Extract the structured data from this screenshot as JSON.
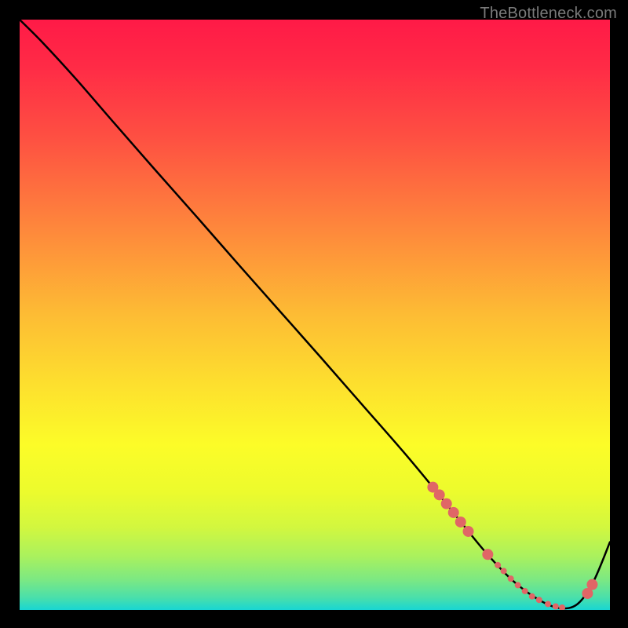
{
  "watermark": "TheBottleneck.com",
  "chart_data": {
    "type": "line",
    "title": "",
    "xlabel": "",
    "ylabel": "",
    "xlim": [
      0,
      1
    ],
    "ylim": [
      0,
      1
    ],
    "background_gradient": {
      "stops": [
        {
          "pos": 0.0,
          "color": "#ff1a47"
        },
        {
          "pos": 0.08,
          "color": "#ff2b46"
        },
        {
          "pos": 0.2,
          "color": "#fe5042"
        },
        {
          "pos": 0.35,
          "color": "#fe863c"
        },
        {
          "pos": 0.5,
          "color": "#fdbc34"
        },
        {
          "pos": 0.62,
          "color": "#fde02e"
        },
        {
          "pos": 0.72,
          "color": "#fcfc28"
        },
        {
          "pos": 0.8,
          "color": "#ecfb2d"
        },
        {
          "pos": 0.86,
          "color": "#d2f73f"
        },
        {
          "pos": 0.91,
          "color": "#a9f15e"
        },
        {
          "pos": 0.95,
          "color": "#7ae884"
        },
        {
          "pos": 0.98,
          "color": "#48dfac"
        },
        {
          "pos": 1.0,
          "color": "#18d6d3"
        }
      ]
    },
    "series": [
      {
        "name": "bottleneck-curve",
        "color": "#000000",
        "x": [
          0.0,
          0.04,
          0.095,
          0.16,
          0.23,
          0.3,
          0.37,
          0.44,
          0.51,
          0.58,
          0.65,
          0.7,
          0.745,
          0.79,
          0.835,
          0.88,
          0.915,
          0.945,
          0.972,
          1.0
        ],
        "y": [
          1.0,
          0.96,
          0.9,
          0.825,
          0.745,
          0.666,
          0.586,
          0.507,
          0.428,
          0.348,
          0.268,
          0.208,
          0.152,
          0.097,
          0.05,
          0.017,
          0.003,
          0.01,
          0.048,
          0.115
        ]
      }
    ],
    "scatter_points": {
      "name": "marked-range",
      "color": "#e06666",
      "radius_main": 7,
      "radius_dot": 4,
      "points": [
        {
          "x": 0.7,
          "y": 0.208,
          "r": 7
        },
        {
          "x": 0.711,
          "y": 0.195,
          "r": 7
        },
        {
          "x": 0.723,
          "y": 0.18,
          "r": 7
        },
        {
          "x": 0.735,
          "y": 0.165,
          "r": 7
        },
        {
          "x": 0.747,
          "y": 0.149,
          "r": 7
        },
        {
          "x": 0.76,
          "y": 0.133,
          "r": 7
        },
        {
          "x": 0.793,
          "y": 0.094,
          "r": 7
        },
        {
          "x": 0.81,
          "y": 0.076,
          "r": 4
        },
        {
          "x": 0.82,
          "y": 0.066,
          "r": 4
        },
        {
          "x": 0.832,
          "y": 0.053,
          "r": 4
        },
        {
          "x": 0.844,
          "y": 0.042,
          "r": 4
        },
        {
          "x": 0.856,
          "y": 0.032,
          "r": 4
        },
        {
          "x": 0.868,
          "y": 0.023,
          "r": 4
        },
        {
          "x": 0.88,
          "y": 0.017,
          "r": 4
        },
        {
          "x": 0.895,
          "y": 0.01,
          "r": 4
        },
        {
          "x": 0.908,
          "y": 0.006,
          "r": 4
        },
        {
          "x": 0.919,
          "y": 0.004,
          "r": 4
        },
        {
          "x": 0.962,
          "y": 0.028,
          "r": 7
        },
        {
          "x": 0.97,
          "y": 0.043,
          "r": 7
        }
      ]
    }
  }
}
